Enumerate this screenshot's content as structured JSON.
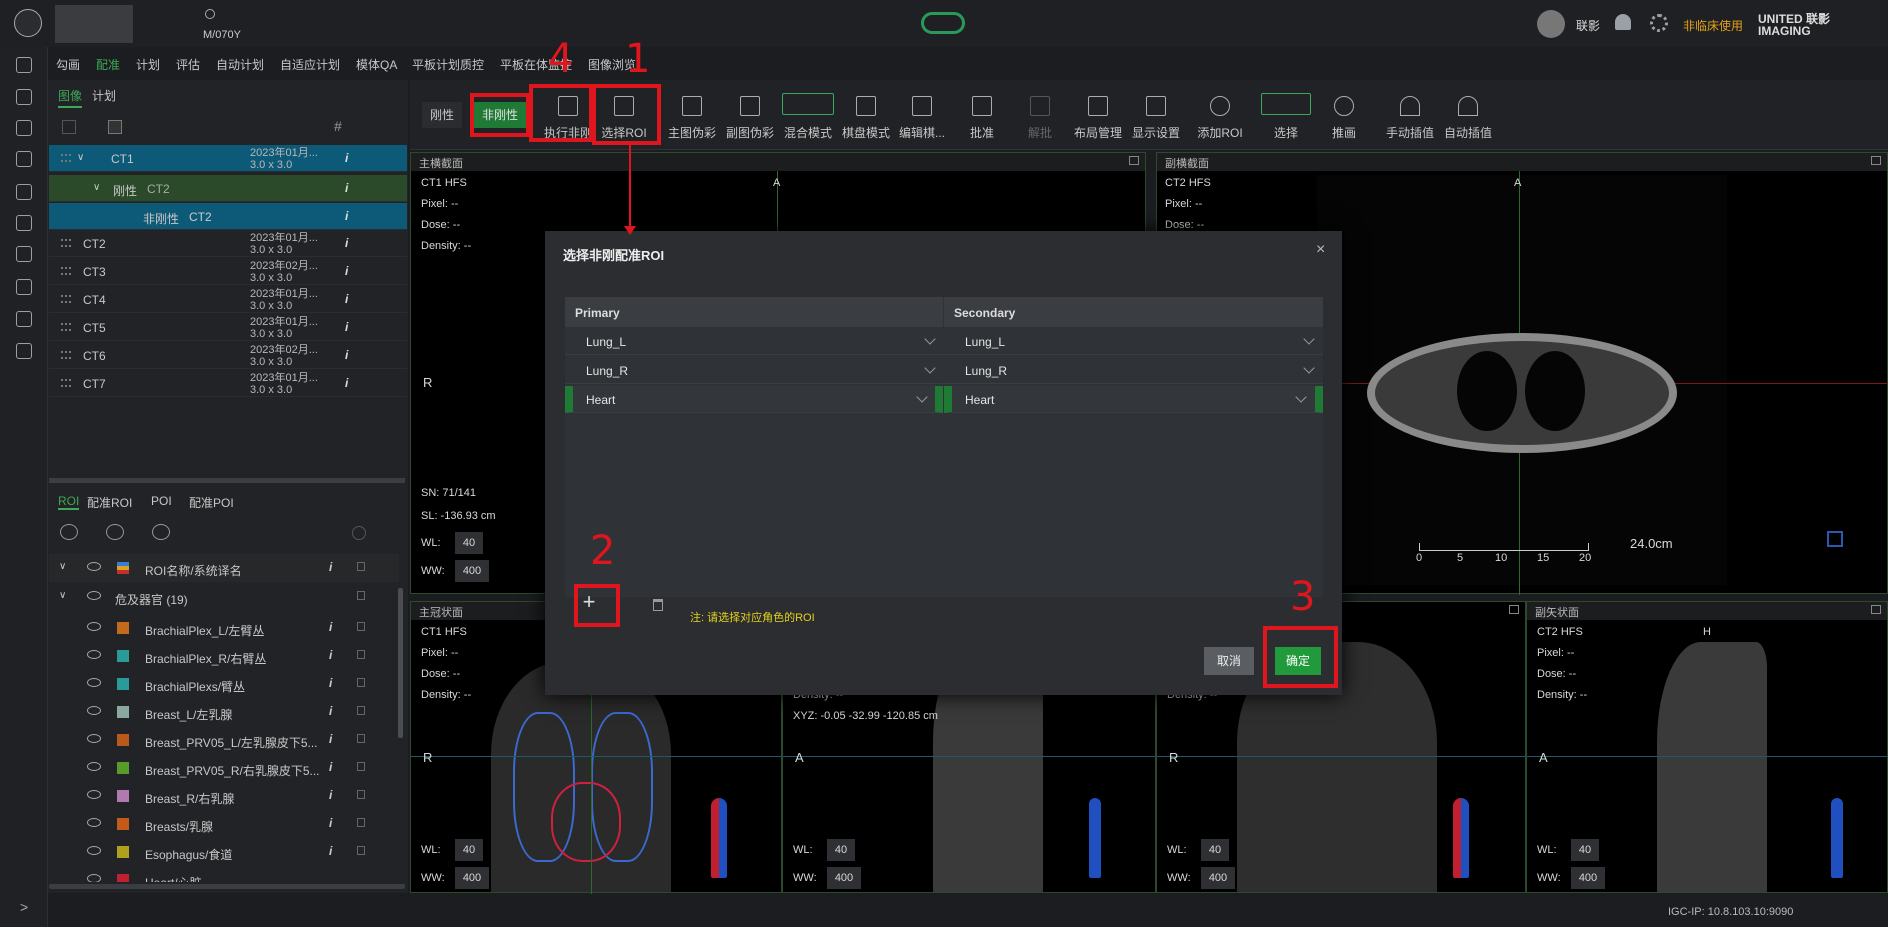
{
  "header": {
    "search_text": "M/070Y",
    "user_name": "联影",
    "clinical_warning": "非临床使用",
    "brand": "UNITED 联影 IMAGING"
  },
  "nav": {
    "items": [
      "勾画",
      "配准",
      "计划",
      "评估",
      "自动计划",
      "自适应计划",
      "模体QA",
      "平板计划质控",
      "平板在体监控",
      "图像浏览"
    ]
  },
  "left_panel": {
    "tabs": [
      "图像",
      "计划"
    ],
    "image_rows": [
      {
        "name": "CT1",
        "date": "2023年01月...",
        "spacing": "3.0 x 3.0"
      },
      {
        "name": "刚性",
        "sub": "CT2"
      },
      {
        "name": "非刚性",
        "sub": "CT2"
      },
      {
        "name": "CT2",
        "date": "2023年01月...",
        "spacing": "3.0 x 3.0"
      },
      {
        "name": "CT3",
        "date": "2023年02月...",
        "spacing": "3.0 x 3.0"
      },
      {
        "name": "CT4",
        "date": "2023年01月...",
        "spacing": "3.0 x 3.0"
      },
      {
        "name": "CT5",
        "date": "2023年01月...",
        "spacing": "3.0 x 3.0"
      },
      {
        "name": "CT6",
        "date": "2023年02月...",
        "spacing": "3.0 x 3.0"
      },
      {
        "name": "CT7",
        "date": "2023年01月...",
        "spacing": "3.0 x 3.0"
      }
    ],
    "roi_tabs": [
      "ROI",
      "配准ROI",
      "POI",
      "配准POI"
    ],
    "roi_header": "ROI名称/系统译名",
    "roi_group": "危及器官 (19)",
    "rois": [
      {
        "name": "BrachialPlex_L/左臂丛",
        "color": "#c46a1c"
      },
      {
        "name": "BrachialPlex_R/右臂丛",
        "color": "#2a9a9a"
      },
      {
        "name": "BrachialPlexs/臂丛",
        "color": "#2a9a9a"
      },
      {
        "name": "Breast_L/左乳腺",
        "color": "#8aa8a0"
      },
      {
        "name": "Breast_PRV05_L/左乳腺皮下5...",
        "color": "#b85a1a"
      },
      {
        "name": "Breast_PRV05_R/右乳腺皮下5...",
        "color": "#5a9a2a"
      },
      {
        "name": "Breast_R/右乳腺",
        "color": "#b07ab0"
      },
      {
        "name": "Breasts/乳腺",
        "color": "#c45a1a"
      },
      {
        "name": "Esophagus/食道",
        "color": "#b0a020"
      },
      {
        "name": "Heart/心脏",
        "color": "#c02030"
      }
    ]
  },
  "toolbar": {
    "items": [
      "刚性",
      "非刚性",
      "执行非刚",
      "选择ROI",
      "主图伪彩",
      "副图伪彩",
      "混合模式",
      "棋盘模式",
      "编辑棋...",
      "批准",
      "解批",
      "布局管理",
      "显示设置",
      "添加ROI",
      "选择",
      "推画",
      "手动插值",
      "自动插值"
    ]
  },
  "viewports": {
    "axial_primary": {
      "title": "主横截面",
      "label": "CT1 HFS",
      "pixel": "Pixel:  --",
      "dose": "Dose:  --",
      "density": "Density:  --",
      "sn": "SN: 71/141",
      "sl": "SL: -136.93 cm",
      "wl_label": "WL:",
      "wl": "40",
      "ww_label": "WW:",
      "ww": "400",
      "orient_top": "A",
      "orient_left": "R"
    },
    "axial_secondary": {
      "title": "副横截面",
      "label": "CT2 HFS",
      "pixel": "Pixel:  --",
      "dose": "Dose:  --",
      "orient_top": "A",
      "ruler": "24.0cm",
      "ruler_ticks": [
        "0",
        "5",
        "10",
        "15",
        "20"
      ]
    },
    "coronal_primary": {
      "title": "主冠状面",
      "label": "CT1 HFS",
      "pixel": "Pixel:  --",
      "dose": "Dose:  --",
      "density": "Density:  --",
      "wl": "40",
      "ww": "400",
      "orient_left": "R"
    },
    "sagittal_primary": {
      "xyz": "XYZ:  -0.05  -32.99  -120.85 cm",
      "density": "Density:  --",
      "wl": "40",
      "ww": "400",
      "orient_left": "A"
    },
    "coronal_secondary": {
      "density": "Density:  --",
      "wl": "40",
      "ww": "400",
      "orient_left": "R"
    },
    "sagittal_secondary": {
      "title": "副矢状面",
      "label": "CT2 HFS",
      "pixel": "Pixel:  --",
      "dose": "Dose:  --",
      "density": "Density:  --",
      "wl": "40",
      "ww": "400",
      "orient_top": "H",
      "orient_left": "A"
    }
  },
  "modal": {
    "title": "选择非刚配准ROI",
    "col_primary": "Primary",
    "col_secondary": "Secondary",
    "rows": [
      {
        "primary": "Lung_L",
        "secondary": "Lung_L"
      },
      {
        "primary": "Lung_R",
        "secondary": "Lung_R"
      },
      {
        "primary": "Heart",
        "secondary": "Heart"
      }
    ],
    "note": "注: 请选择对应角色的ROI",
    "cancel": "取消",
    "ok": "确定"
  },
  "annotations": [
    "1",
    "2",
    "3",
    "4"
  ],
  "status": {
    "ip": "IGC-IP: 10.8.103.10:9090"
  }
}
